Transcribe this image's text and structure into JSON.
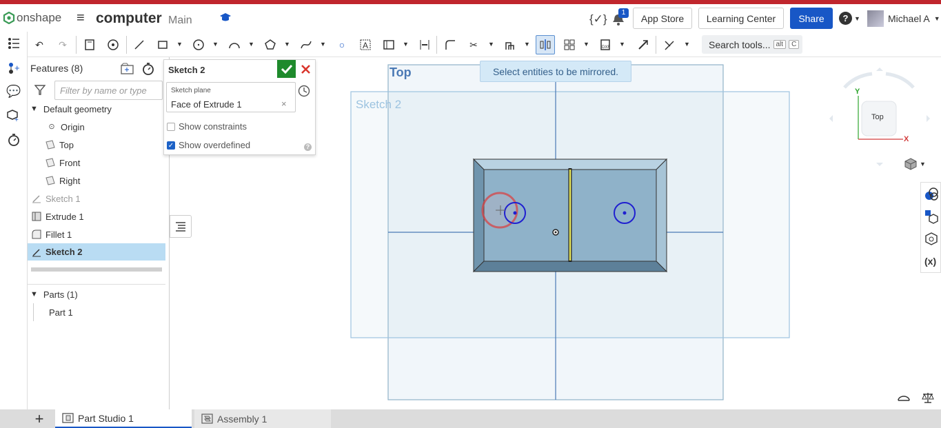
{
  "header": {
    "brand": "onshape",
    "doc_title": "computer",
    "branch": "Main",
    "notification_count": "1",
    "app_store": "App Store",
    "learning_center": "Learning Center",
    "share": "Share",
    "user": "Michael A"
  },
  "toolbar": {
    "search_label": "Search tools...",
    "search_kbd1": "alt",
    "search_kbd2": "C"
  },
  "features": {
    "title": "Features (8)",
    "filter_placeholder": "Filter by name or type",
    "default_geometry": "Default geometry",
    "items": [
      {
        "label": "Origin"
      },
      {
        "label": "Top"
      },
      {
        "label": "Front"
      },
      {
        "label": "Right"
      },
      {
        "label": "Sketch 1"
      },
      {
        "label": "Extrude 1"
      },
      {
        "label": "Fillet 1"
      },
      {
        "label": "Sketch 2"
      }
    ],
    "parts_header": "Parts (1)",
    "parts": [
      {
        "label": "Part 1"
      }
    ]
  },
  "dialog": {
    "title": "Sketch 2",
    "plane_label": "Sketch plane",
    "plane_value": "Face of Extrude 1",
    "plane_clear": "×",
    "show_constraints": "Show constraints",
    "show_overdefined": "Show overdefined",
    "help": "?"
  },
  "viewport": {
    "hint": "Select entities to be mirrored.",
    "top_plane_label": "Top",
    "sketch_label": "Sketch 2",
    "viewcube_face": "Top",
    "axis_y": "Y",
    "axis_x": "X"
  },
  "tabs": [
    {
      "label": "Part Studio 1"
    },
    {
      "label": "Assembly 1"
    }
  ],
  "colors": {
    "brand_blue": "#1857c6",
    "accent_red": "#c0262d",
    "confirm_green": "#1e8a2c",
    "selection_blue": "#b9dcf3",
    "sketch_blue": "#1f1fd0",
    "part_fill": "#8fb2c9"
  }
}
